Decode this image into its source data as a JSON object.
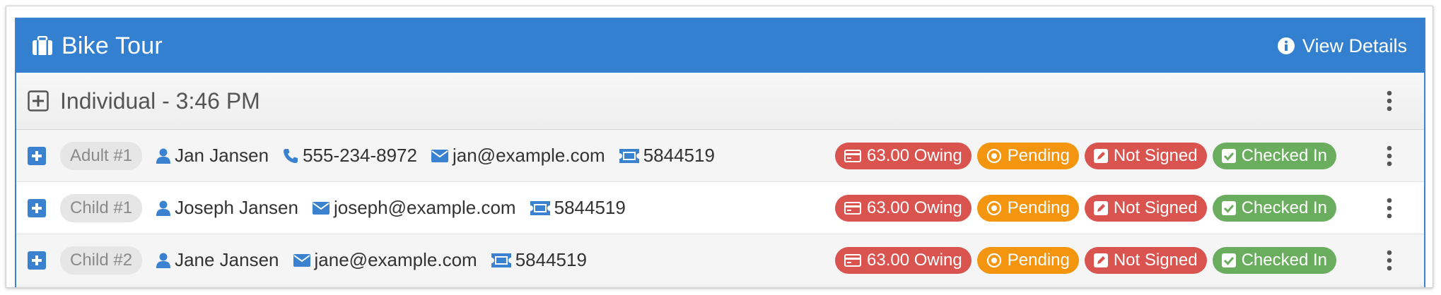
{
  "card": {
    "title": "Bike Tour",
    "view_details": "View Details",
    "header_icon": "briefcase-icon",
    "header_color": "#3380d0"
  },
  "group": {
    "title": "Individual - 3:46 PM",
    "expand_icon": "plus-square-icon"
  },
  "participants": [
    {
      "role": "Adult #1",
      "name": "Jan Jansen",
      "phone": "555-234-8972",
      "email": "jan@example.com",
      "ticket": "5844519",
      "badges": {
        "owing": "63.00 Owing",
        "pending": "Pending",
        "signed": "Not Signed",
        "checked": "Checked In"
      }
    },
    {
      "role": "Child #1",
      "name": "Joseph Jansen",
      "email": "joseph@example.com",
      "ticket": "5844519",
      "badges": {
        "owing": "63.00 Owing",
        "pending": "Pending",
        "signed": "Not Signed",
        "checked": "Checked In"
      }
    },
    {
      "role": "Child #2",
      "name": "Jane Jansen",
      "email": "jane@example.com",
      "ticket": "5844519",
      "badges": {
        "owing": "63.00 Owing",
        "pending": "Pending",
        "signed": "Not Signed",
        "checked": "Checked In"
      }
    }
  ],
  "colors": {
    "accent": "#3a82cf",
    "owing": "#d9534f",
    "pending": "#f3950f",
    "not_signed": "#d9534f",
    "checked_in": "#6aad5e"
  }
}
